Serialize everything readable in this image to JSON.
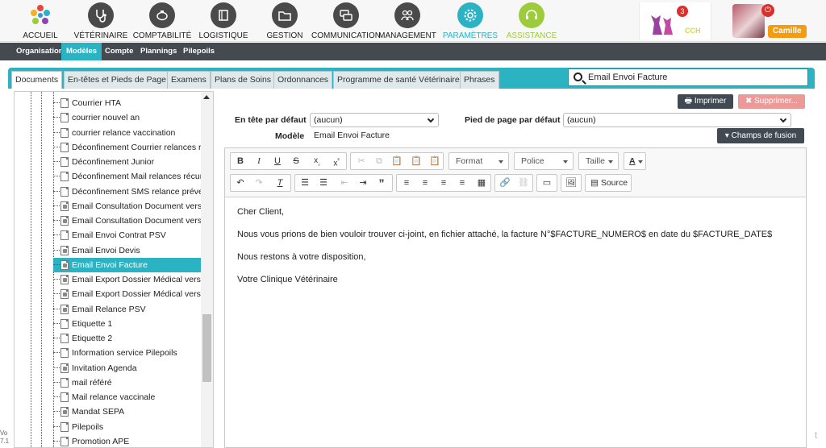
{
  "topnav": {
    "items": [
      {
        "label": "ACCUEIL",
        "icon": "home-logo-icon"
      },
      {
        "label": "VÉTÉRINAIRE",
        "icon": "stethoscope-icon"
      },
      {
        "label": "COMPTABILITÉ",
        "icon": "piggy-bank-icon"
      },
      {
        "label": "LOGISTIQUE",
        "icon": "book-icon"
      },
      {
        "label": "GESTION",
        "icon": "folder-icon"
      },
      {
        "label": "COMMUNICATION",
        "icon": "chat-icon"
      },
      {
        "label": "MANAGEMENT",
        "icon": "team-icon"
      },
      {
        "label": "PARAMÈTRES",
        "icon": "gear-icon"
      },
      {
        "label": "ASSISTANCE",
        "icon": "headset-icon"
      }
    ],
    "active": "PARAMÈTRES",
    "notifications": "3",
    "clinic_code": "CCH",
    "user_name": "Camille"
  },
  "subnav": {
    "items": [
      "Organisation",
      "Modèles",
      "Compte",
      "Plannings",
      "Pilepoils"
    ],
    "active": "Modèles"
  },
  "tabs": {
    "items": [
      "Documents",
      "En-têtes et Pieds de Page",
      "Examens",
      "Plans de Soins",
      "Ordonnances",
      "Programme de santé Vétérinaire",
      "Phrases"
    ],
    "active": "Documents"
  },
  "search": {
    "value": "Email Envoi Facture"
  },
  "tree": {
    "items": [
      {
        "label": "Courrier HTA",
        "locked": false
      },
      {
        "label": "courrier nouvel an",
        "locked": false
      },
      {
        "label": "courrier relance vaccination",
        "locked": false
      },
      {
        "label": "Déconfinement Courrier relances récurrentes",
        "locked": false
      },
      {
        "label": "Déconfinement Junior",
        "locked": false
      },
      {
        "label": "Déconfinement Mail relances récurrentes",
        "locked": false
      },
      {
        "label": "Déconfinement SMS relance prévention",
        "locked": false
      },
      {
        "label": "Email Consultation Document vers Propriétaire",
        "locked": true
      },
      {
        "label": "Email Consultation Document vers Vétérinaire",
        "locked": true
      },
      {
        "label": "Email Envoi Contrat PSV",
        "locked": false
      },
      {
        "label": "Email Envoi Devis",
        "locked": true
      },
      {
        "label": "Email Envoi Facture",
        "locked": true
      },
      {
        "label": "Email Export Dossier Médical vers Propriétaire",
        "locked": true
      },
      {
        "label": "Email Export Dossier Médical vers Vétérinaire",
        "locked": true
      },
      {
        "label": "Email Relance PSV",
        "locked": true
      },
      {
        "label": "Etiquette 1",
        "locked": false
      },
      {
        "label": "Etiquette 2",
        "locked": false
      },
      {
        "label": "Information service Pilepoils",
        "locked": false
      },
      {
        "label": "Invitation Agenda",
        "locked": true
      },
      {
        "label": "mail référé",
        "locked": false
      },
      {
        "label": "Mail relance vaccinale",
        "locked": false
      },
      {
        "label": "Mandat SEPA",
        "locked": true
      },
      {
        "label": "Pilepoils",
        "locked": false
      },
      {
        "label": "Promotion APE",
        "locked": false
      }
    ],
    "selected": "Email Envoi Facture"
  },
  "actions": {
    "print_label": "Imprimer",
    "delete_label": "Supprimer..."
  },
  "form": {
    "header_label": "En tête par défaut",
    "header_value": "(aucun)",
    "footer_label": "Pied de page par défaut",
    "footer_value": "(aucun)",
    "model_label": "Modèle",
    "model_value": "Email Envoi Facture",
    "merge_fields_label": "Champs de fusion"
  },
  "toolbar": {
    "format": "Format",
    "font": "Police",
    "size": "Taille",
    "source": "Source"
  },
  "editor": {
    "paragraphs": [
      "Cher Client,",
      "Nous vous prions de bien vouloir trouver ci-joint, en fichier attaché, la facture N°$FACTURE_NUMERO$ en date du $FACTURE_DATE$",
      "Nous restons à votre disposition,",
      "Votre Clinique Vétérinaire"
    ]
  },
  "colors": {
    "accent": "#2bb3c4",
    "dark": "#414a52",
    "assist": "#9ccc3c",
    "danger": "#ec9a98"
  },
  "misc": {
    "left_fragment": "Vo\n7.1"
  }
}
